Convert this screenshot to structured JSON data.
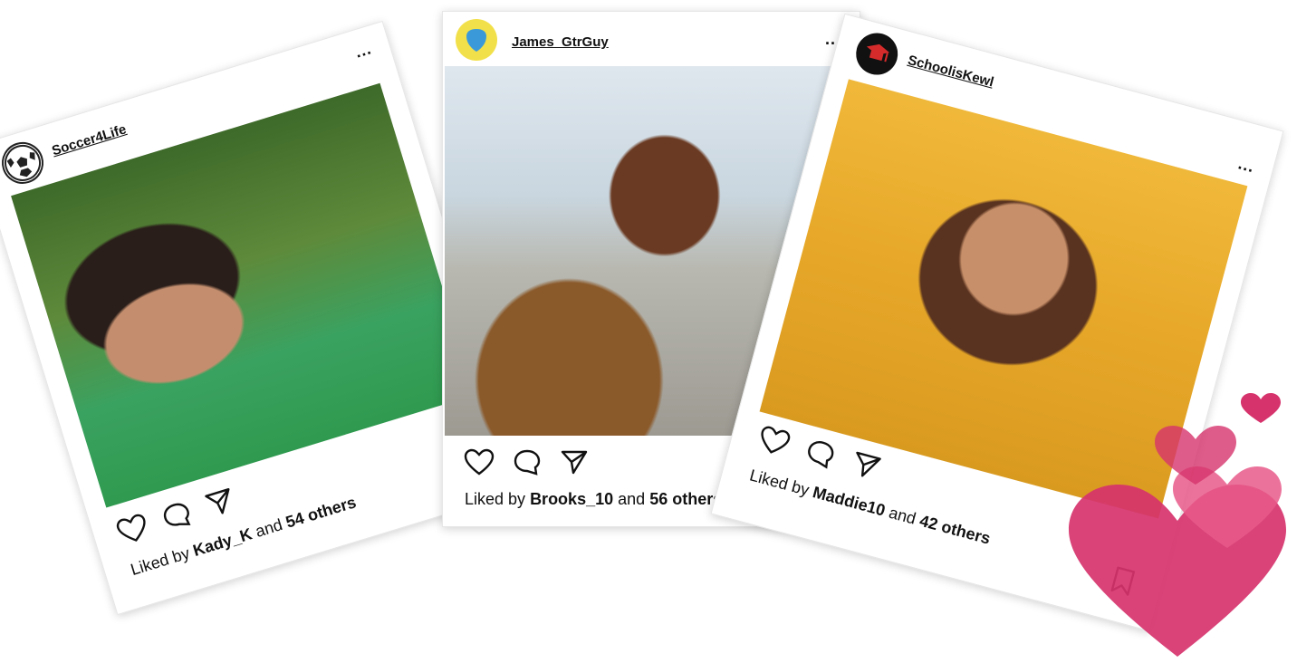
{
  "posts": [
    {
      "username": "Soccer4Life",
      "avatar_icon": "soccer-ball-icon",
      "liked_prefix": "Liked by",
      "liked_user": "Kady_K",
      "liked_and": "and",
      "liked_count": "54 others"
    },
    {
      "username": "James_GtrGuy",
      "avatar_icon": "blue-shield-icon",
      "liked_prefix": "Liked by",
      "liked_user": "Brooks_10",
      "liked_and": "and",
      "liked_count": "56 others"
    },
    {
      "username": "SchoolisKewl",
      "avatar_icon": "graduation-cap-icon",
      "liked_prefix": "Liked by",
      "liked_user": "Maddie10",
      "liked_and": "and",
      "liked_count": "42 others"
    }
  ],
  "more_label": "...",
  "colors": {
    "heart_pink": "#d6336c",
    "heart_light": "#e85a8a",
    "soccer_green": "#2f9a4f"
  }
}
